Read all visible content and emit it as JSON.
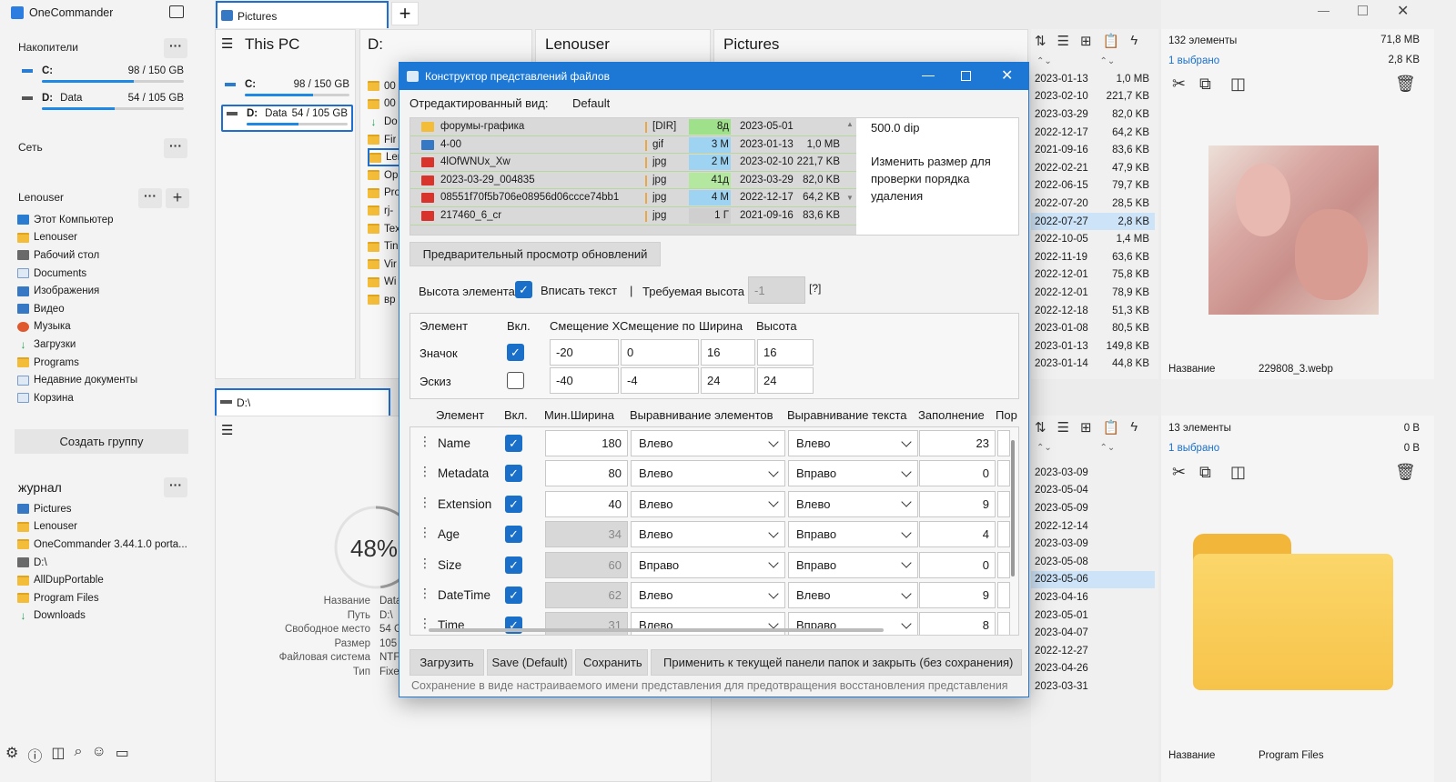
{
  "app": {
    "title": "OneCommander"
  },
  "sidebar": {
    "drives_title": "Накопители",
    "drives": [
      {
        "letter": "C:",
        "label": "",
        "usage": "98 / 150 GB",
        "used_fraction": 0.65
      },
      {
        "letter": "D:",
        "label": "Data",
        "usage": "54 / 105 GB",
        "used_fraction": 0.51
      }
    ],
    "network_title": "Сеть",
    "favorites_title": "Lenouser",
    "favorites": [
      "Этот Компьютер",
      "Lenouser",
      "Рабочий стол",
      "Documents",
      "Изображения",
      "Видео",
      "Музыка",
      "Загрузки",
      "Programs",
      "Недавние документы",
      "Корзина"
    ],
    "create_group": "Создать группу",
    "journal_title": "журнал",
    "journal": [
      "Pictures",
      "Lenouser",
      "OneCommander 3.44.1.0 porta...",
      "D:\\",
      "AllDupPortable",
      "Program Files",
      "Downloads"
    ]
  },
  "top_tab": {
    "label": "Pictures"
  },
  "columns": {
    "thispc": "This PC",
    "d": "D:",
    "lenouser": "Lenouser",
    "pictures": "Pictures"
  },
  "thispc_drives": [
    {
      "letter": "C:",
      "label": "",
      "usage": "98 / 150 GB",
      "used_fraction": 0.65
    },
    {
      "letter": "D:",
      "label": "Data",
      "usage": "54 / 105 GB",
      "used_fraction": 0.51
    }
  ],
  "d_column_items": [
    "00",
    "00",
    "Do",
    "Fir",
    "Ler",
    "Op",
    "Pro",
    "rj-",
    "Tex",
    "Tin",
    "Vir",
    "Wi",
    "вр"
  ],
  "bottom_tab": {
    "label": "D:\\"
  },
  "disk_info": {
    "percent": "48%",
    "used_fraction": 0.48,
    "labels": [
      "Название",
      "Путь",
      "Свободное место",
      "Размер",
      "Файловая система",
      "Тип"
    ],
    "values": [
      "Data",
      "D:\\",
      "54 G",
      "105",
      "NTF",
      "Fixe"
    ]
  },
  "right_top": {
    "count": "132 элементы",
    "size": "71,8 MB",
    "selected": "1 выбрано",
    "selected_size": "2,8 KB",
    "name_label": "Название",
    "name_value": "229808_3.webp",
    "rows": [
      [
        "2023-01-13",
        "1,0 MB"
      ],
      [
        "2023-02-10",
        "221,7 KB"
      ],
      [
        "2023-03-29",
        "82,0 KB"
      ],
      [
        "2022-12-17",
        "64,2 KB"
      ],
      [
        "2021-09-16",
        "83,6 KB"
      ],
      [
        "2022-02-21",
        "47,9 KB"
      ],
      [
        "2022-06-15",
        "79,7 KB"
      ],
      [
        "2022-07-20",
        "28,5 KB"
      ],
      [
        "2022-07-27",
        "2,8 KB"
      ],
      [
        "2022-10-05",
        "1,4 MB"
      ],
      [
        "2022-11-19",
        "63,6 KB"
      ],
      [
        "2022-12-01",
        "75,8 KB"
      ],
      [
        "2022-12-01",
        "78,9 KB"
      ],
      [
        "2022-12-18",
        "51,3 KB"
      ],
      [
        "2023-01-08",
        "80,5 KB"
      ],
      [
        "2023-01-13",
        "149,8 KB"
      ],
      [
        "2023-01-14",
        "44,8 KB"
      ]
    ],
    "selected_row": 8
  },
  "right_bottom": {
    "count": "13 элементы",
    "size": "0 B",
    "selected": "1 выбрано",
    "selected_size": "0 B",
    "name_label": "Название",
    "name_value": "Program Files",
    "rows": [
      "2023-03-09",
      "2023-05-04",
      "2023-05-09",
      "2022-12-14",
      "2023-03-09",
      "2023-05-08",
      "2023-05-06",
      "2023-04-16",
      "2023-05-01",
      "2023-04-07",
      "2022-12-27",
      "2023-04-26",
      "2023-03-31"
    ],
    "selected_row": 6
  },
  "dialog": {
    "title": "Конструктор представлений файлов",
    "edited_view_label": "Отредактированный вид:",
    "edited_view_value": "Default",
    "preview_rows": [
      {
        "name": "форумы-графика",
        "ext": "[DIR]",
        "age": "8д",
        "date": "2023-05-01",
        "size": ""
      },
      {
        "name": "4-00",
        "ext": "gif",
        "age": "3 M",
        "date": "2023-01-13",
        "size": "1,0 MB"
      },
      {
        "name": "4lOfWNUx_Xw",
        "ext": "jpg",
        "age": "2 M",
        "date": "2023-02-10",
        "size": "221,7 KB"
      },
      {
        "name": "2023-03-29_004835",
        "ext": "jpg",
        "age": "41д",
        "date": "2023-03-29",
        "size": "82,0 KB"
      },
      {
        "name": "08551f70f5b706e08956d06ccce74bb1",
        "ext": "jpg",
        "age": "4 M",
        "date": "2022-12-17",
        "size": "64,2 KB"
      },
      {
        "name": "217460_6_cr",
        "ext": "jpg",
        "age": "1 Г",
        "date": "2021-09-16",
        "size": "83,6 KB"
      }
    ],
    "dip": "500.0 dip",
    "resize_hint": "Изменить размер для проверки порядка удаления",
    "preview_button": "Предварительный просмотр обновлений",
    "item_height_label": "Высота элемента",
    "fit_text_label": "Вписать текст",
    "separator": "|",
    "required_height_label": "Требуемая высота",
    "required_height_value": "-1",
    "help": "[?]",
    "icon_table": {
      "headers": [
        "Элемент",
        "Вкл.",
        "Смещение Х",
        "Смещение по",
        "Ширина",
        "Высота"
      ],
      "rows": [
        {
          "name": "Значок",
          "on": true,
          "x": "-20",
          "y": "0",
          "w": "16",
          "h": "16"
        },
        {
          "name": "Эскиз",
          "on": false,
          "x": "-40",
          "y": "-4",
          "w": "24",
          "h": "24"
        }
      ]
    },
    "col_table": {
      "headers": [
        "Элемент",
        "Вкл.",
        "Мин.Ширина",
        "Выравнивание элементов",
        "Выравнивание текста",
        "Заполнение",
        "Пор"
      ],
      "rows": [
        {
          "name": "Name",
          "on": true,
          "minw": "180",
          "dis": false,
          "align": "Влево",
          "talign": "Влево",
          "pad": "23"
        },
        {
          "name": "Metadata",
          "on": true,
          "minw": "80",
          "dis": false,
          "align": "Влево",
          "talign": "Вправо",
          "pad": "0"
        },
        {
          "name": "Extension",
          "on": true,
          "minw": "40",
          "dis": false,
          "align": "Влево",
          "talign": "Влево",
          "pad": "9"
        },
        {
          "name": "Age",
          "on": true,
          "minw": "34",
          "dis": true,
          "align": "Влево",
          "talign": "Вправо",
          "pad": "4"
        },
        {
          "name": "Size",
          "on": true,
          "minw": "60",
          "dis": true,
          "align": "Вправо",
          "talign": "Вправо",
          "pad": "0"
        },
        {
          "name": "DateTime",
          "on": true,
          "minw": "62",
          "dis": true,
          "align": "Влево",
          "talign": "Влево",
          "pad": "9"
        },
        {
          "name": "Time",
          "on": true,
          "minw": "31",
          "dis": true,
          "align": "Влево",
          "talign": "Вправо",
          "pad": "8"
        }
      ]
    },
    "buttons": {
      "load": "Загрузить",
      "save_default": "Save (Default)",
      "save": "Сохранить",
      "apply": "Применить к текущей панели папок и закрыть (без сохранения)"
    },
    "status": "Сохранение в виде настраиваемого имени представления для предотвращения восстановления представления"
  },
  "icons": [
    "settings-icon",
    "info-icon",
    "layout-icon",
    "search-icon",
    "user-icon",
    "window-icon",
    "sort-icon",
    "list-icon",
    "new-tab-icon",
    "clipboard-icon",
    "lightning-icon",
    "cut-icon",
    "copy-icon",
    "compare-icon",
    "trash-icon"
  ]
}
